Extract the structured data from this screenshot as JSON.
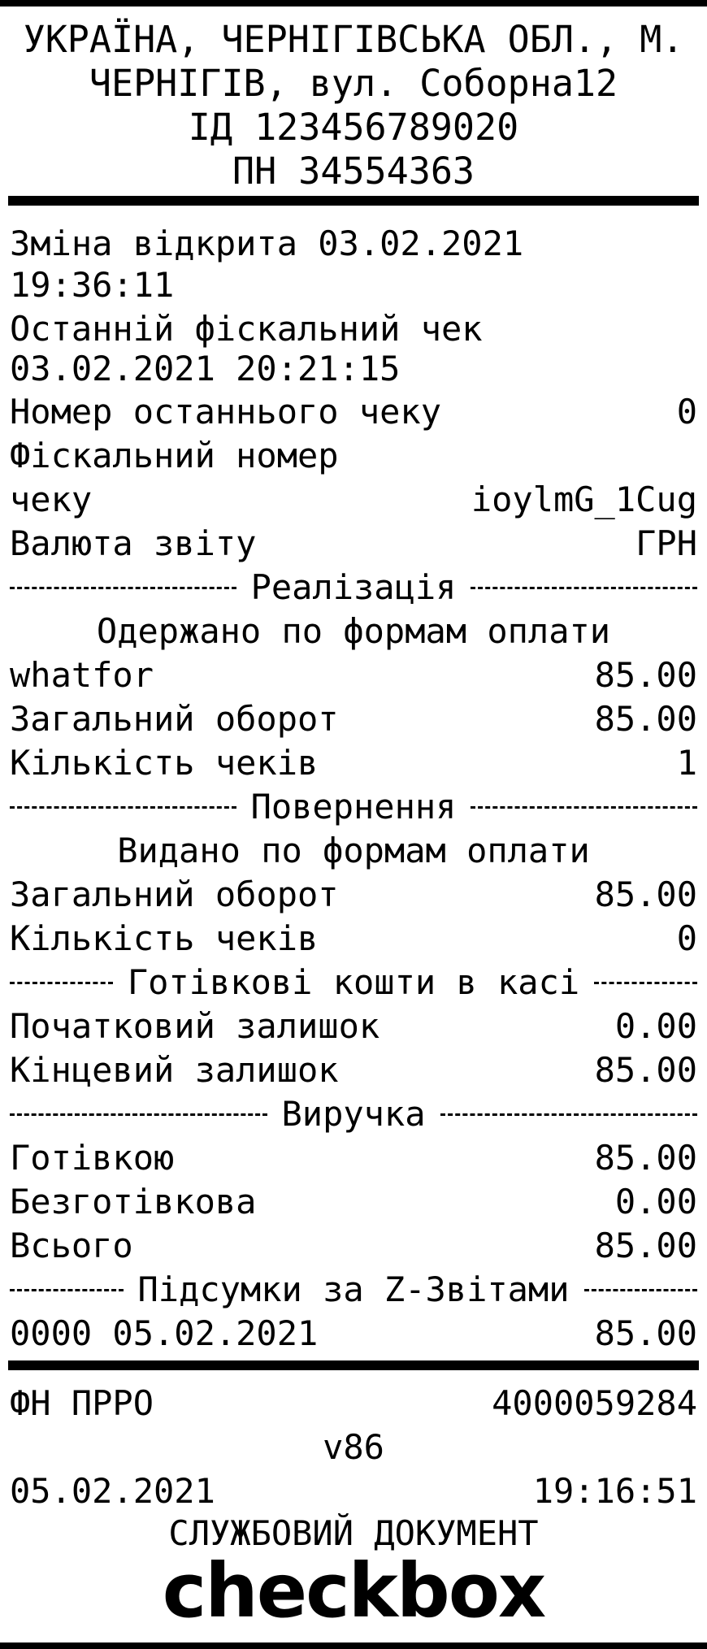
{
  "header": {
    "lines": [
      "УКРАЇНА, ЧЕРНІГІВСЬКА ОБЛ., М.",
      "ЧЕРНІГІВ, вул. Соборна12",
      "ІД 123456789020",
      "ПН 34554363"
    ]
  },
  "shift": {
    "opened_label": "Зміна відкрита 03.02.2021",
    "opened_time": "19:36:11",
    "last_fiscal_label": "Останній фіскальний чек",
    "last_fiscal_datetime": "03.02.2021 20:21:15",
    "last_receipt_number_label": "Номер останнього чеку",
    "last_receipt_number_value": "0",
    "fiscal_number_label_1": "Фіскальний номер",
    "fiscal_number_label_2": "чеку",
    "fiscal_number_value": "ioylmG_1Cug",
    "currency_label": "Валюта звіту",
    "currency_value": "ГРН"
  },
  "sales": {
    "section_title": "Реалізація",
    "payments_title": "Одержано по формам оплати",
    "payment_name": "whatfor",
    "payment_value": "85.00",
    "turnover_label": "Загальний оборот",
    "turnover_value": "85.00",
    "receipts_label": "Кількість чеків",
    "receipts_value": "1"
  },
  "returns": {
    "section_title": "Повернення",
    "payments_title": "Видано по формам оплати",
    "turnover_label": "Загальний оборот",
    "turnover_value": "85.00",
    "receipts_label": "Кількість чеків",
    "receipts_value": "0"
  },
  "cash": {
    "section_title": "Готівкові кошти в касі",
    "opening_label": "Початковий залишок",
    "opening_value": "0.00",
    "closing_label": "Кінцевий залишок",
    "closing_value": "85.00"
  },
  "revenue": {
    "section_title": "Виручка",
    "cash_label": "Готівкою",
    "cash_value": "85.00",
    "cashless_label": "Безготівкова",
    "cashless_value": "0.00",
    "total_label": "Всього",
    "total_value": "85.00"
  },
  "z_reports": {
    "section_title": "Підсумки за Z-Звітами",
    "row_left": "0000 05.02.2021",
    "row_value": "85.00"
  },
  "footer": {
    "prro_label": "ФН ПРРО",
    "prro_value": "4000059284",
    "version": "v86",
    "date": "05.02.2021",
    "time": "19:16:51",
    "doc_type": "СЛУЖБОВИЙ ДОКУМЕНТ",
    "brand": "checkbox"
  }
}
